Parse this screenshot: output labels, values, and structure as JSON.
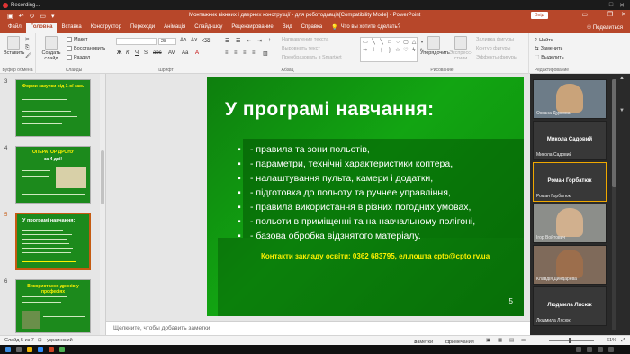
{
  "recording": {
    "label": "Recording..."
  },
  "window": {
    "title": "Монтажник вікнних і дверних конструкції - для роботодавців[Compatibility Mode] - PowerPoint",
    "signin": "Вхід"
  },
  "tabs": [
    "Файл",
    "Головна",
    "Вставка",
    "Конструктор",
    "Переходи",
    "Анімація",
    "Слайд-шоу",
    "Рецензирование",
    "Вид",
    "Справка",
    "Что вы хотите сделать?"
  ],
  "share": "Поделиться",
  "ribbon": {
    "clipboard": {
      "paste": "Вставить",
      "name": "Буфер обмена"
    },
    "slides": {
      "create": "Создать слайд",
      "layout": "Макет",
      "reset": "Восстановить",
      "section": "Раздел",
      "name": "Слайды"
    },
    "font": {
      "name": "Шрифт",
      "size": "28"
    },
    "paragraph": {
      "name": "Абзац",
      "direction": "Направление текста",
      "align": "Выровнять текст",
      "smartart": "Преобразовать в SmartArt"
    },
    "drawing": {
      "arrange": "Упорядочить",
      "styles": "Экспресс-стили",
      "fill": "Заливка фигуры",
      "outline": "Контур фигуры",
      "effects": "Эффекты фигуры",
      "name": "Рисование"
    },
    "editing": {
      "find": "Найти",
      "replace": "Заменить",
      "select": "Выделить",
      "name": "Редактирование"
    }
  },
  "thumbnails": [
    {
      "num": "3",
      "title": "Форми закупки від 1-ої зам.",
      "selected": false
    },
    {
      "num": "4",
      "title": "ОПЕРАТОР ДРОНУ",
      "subtitle": "за 4 дні!",
      "selected": false
    },
    {
      "num": "5",
      "title": "У програмі навчання:",
      "selected": true
    },
    {
      "num": "6",
      "title": "Використання дронів у професіях",
      "selected": false
    }
  ],
  "slide": {
    "title": "У програмі навчання:",
    "bullet": "▪",
    "items": [
      "- правила та зони польотів,",
      "- параметри, технічні характеристики коптера,",
      "- налаштування пульта, камери і додатки,",
      "- підготовка до польоту та ручнее управління,",
      "- правила використання в різних погодних умовах,",
      "- польоти в приміщенні та на навчальному полігоні,",
      "- базова обробка відзнятого матеріалу."
    ],
    "contacts": "Контакти закладу освіти: 0362 683795, ел.пошта cpto@cpto.rv.ua",
    "number": "5"
  },
  "notes_placeholder": "Щелкните, чтобы добавить заметки",
  "participants": [
    {
      "name": "Оксана Дуркова",
      "video": true,
      "face": "#c9a37a"
    },
    {
      "name": "Микола Садовий",
      "caption": "Микола Садовий",
      "video": false
    },
    {
      "name": "Роман Горбатюк",
      "caption": "Роман Горбатюк",
      "video": false,
      "active": true
    },
    {
      "name": "Ігор Войтович",
      "video": true,
      "face": "#d1b08e"
    },
    {
      "name": "Клавдія Диндарева",
      "video": true,
      "face": "#9c6e4c"
    },
    {
      "name": "Людмила Лясюк",
      "caption": "Людмила Лясюк",
      "video": false
    }
  ],
  "status": {
    "slide": "Слайд 5 из 7",
    "lang": "украинский",
    "notes": "Заметки",
    "comments": "Примечания",
    "zoom": "61%"
  },
  "colors": {
    "accent": "#b7472a",
    "slide_bg": "#109d10",
    "contacts": "#fff200"
  }
}
